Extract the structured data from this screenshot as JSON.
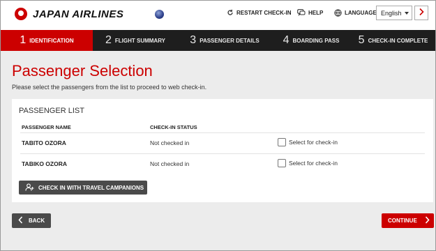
{
  "header": {
    "brand": "JAPAN AIRLINES",
    "restart_label": "RESTART CHECK-IN",
    "help_label": "HELP",
    "language_label": "LANGUAGE:",
    "language_value": "English",
    "brand_color": "#cc0000"
  },
  "steps": [
    {
      "num": "1",
      "label": "IDENTIFICATION",
      "active": true
    },
    {
      "num": "2",
      "label": "FLIGHT SUMMARY",
      "active": false
    },
    {
      "num": "3",
      "label": "PASSENGER DETAILS",
      "active": false
    },
    {
      "num": "4",
      "label": "BOARDING PASS",
      "active": false
    },
    {
      "num": "5",
      "label": "CHECK-IN COMPLETE",
      "active": false
    }
  ],
  "main": {
    "title": "Passenger Selection",
    "subtitle": "Please select the passengers from the list to proceed to web check-in."
  },
  "passenger_list": {
    "title": "PASSENGER LIST",
    "columns": [
      "PASSENGER NAME",
      "CHECK-IN STATUS"
    ],
    "rows": [
      {
        "name": "TABITO OZORA",
        "status": "Not checked in",
        "select_label": "Select for check-in",
        "checked": false
      },
      {
        "name": "TABIKO OZORA",
        "status": "Not checked in",
        "select_label": "Select for check-in",
        "checked": false
      }
    ],
    "companions_button": "CHECK IN WITH TRAVEL CAMPANIONS"
  },
  "footer": {
    "back_label": "BACK",
    "continue_label": "CONTINUE"
  }
}
